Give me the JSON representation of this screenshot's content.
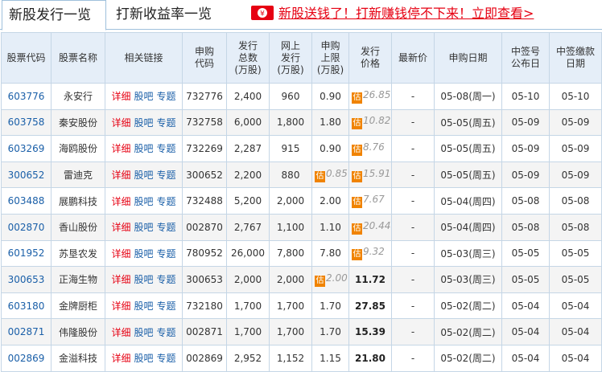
{
  "tabs": [
    {
      "label": "新股发行一览",
      "active": true
    },
    {
      "label": "打新收益率一览",
      "active": false
    }
  ],
  "promo": {
    "text": "新股送钱了！打新赚钱停不下来！立即查看>",
    "icon": "money-bag-icon"
  },
  "colors": {
    "accent_red": "#e60012",
    "link_blue": "#1a5fa8",
    "header_bg": "#e5eef8",
    "estimate_badge": "#f08300"
  },
  "estimate_badge": "估",
  "table": {
    "headers": {
      "code": "股票代码",
      "name": "股票名称",
      "links": "相关链接",
      "sub_code": [
        "申购",
        "代码"
      ],
      "total": [
        "发行",
        "总数",
        "(万股)"
      ],
      "online": [
        "网上",
        "发行",
        "(万股)"
      ],
      "limit": [
        "申购",
        "上限",
        "(万股)"
      ],
      "price": [
        "发行",
        "价格"
      ],
      "latest": "最新价",
      "sub_date": "申购日期",
      "announce": [
        "中签号",
        "公布日"
      ],
      "pay": [
        "中签缴款",
        "日期"
      ]
    },
    "link_labels": {
      "detail": "详细",
      "bar": "股吧",
      "topic": "专题"
    },
    "rows": [
      {
        "code": "603776",
        "name": "永安行",
        "sub_code": "732776",
        "total": "2,400",
        "online": "960",
        "limit": "0.90",
        "limit_est": false,
        "price": "26.85",
        "price_est": true,
        "latest": "-",
        "sub_date": "05-08(周一)",
        "announce": "05-10",
        "pay": "05-10"
      },
      {
        "code": "603758",
        "name": "秦安股份",
        "sub_code": "732758",
        "total": "6,000",
        "online": "1,800",
        "limit": "1.80",
        "limit_est": false,
        "price": "10.82",
        "price_est": true,
        "latest": "-",
        "sub_date": "05-05(周五)",
        "announce": "05-09",
        "pay": "05-09"
      },
      {
        "code": "603269",
        "name": "海鸥股份",
        "sub_code": "732269",
        "total": "2,287",
        "online": "915",
        "limit": "0.90",
        "limit_est": false,
        "price": "8.76",
        "price_est": true,
        "latest": "-",
        "sub_date": "05-05(周五)",
        "announce": "05-09",
        "pay": "05-09"
      },
      {
        "code": "300652",
        "name": "雷迪克",
        "sub_code": "300652",
        "total": "2,200",
        "online": "880",
        "limit": "0.85",
        "limit_est": true,
        "price": "15.91",
        "price_est": true,
        "latest": "-",
        "sub_date": "05-05(周五)",
        "announce": "05-09",
        "pay": "05-09"
      },
      {
        "code": "603488",
        "name": "展鹏科技",
        "sub_code": "732488",
        "total": "5,200",
        "online": "2,000",
        "limit": "2.00",
        "limit_est": false,
        "price": "7.67",
        "price_est": true,
        "latest": "-",
        "sub_date": "05-04(周四)",
        "announce": "05-08",
        "pay": "05-08"
      },
      {
        "code": "002870",
        "name": "香山股份",
        "sub_code": "002870",
        "total": "2,767",
        "online": "1,100",
        "limit": "1.10",
        "limit_est": false,
        "price": "20.44",
        "price_est": true,
        "latest": "-",
        "sub_date": "05-04(周四)",
        "announce": "05-08",
        "pay": "05-08"
      },
      {
        "code": "601952",
        "name": "苏垦农发",
        "sub_code": "780952",
        "total": "26,000",
        "online": "7,800",
        "limit": "7.80",
        "limit_est": false,
        "price": "9.32",
        "price_est": true,
        "latest": "-",
        "sub_date": "05-03(周三)",
        "announce": "05-05",
        "pay": "05-05"
      },
      {
        "code": "300653",
        "name": "正海生物",
        "sub_code": "300653",
        "total": "2,000",
        "online": "2,000",
        "limit": "2.00",
        "limit_est": true,
        "price": "11.72",
        "price_est": false,
        "latest": "-",
        "sub_date": "05-03(周三)",
        "announce": "05-05",
        "pay": "05-05"
      },
      {
        "code": "603180",
        "name": "金牌厨柜",
        "sub_code": "732180",
        "total": "1,700",
        "online": "1,700",
        "limit": "1.70",
        "limit_est": false,
        "price": "27.85",
        "price_est": false,
        "latest": "-",
        "sub_date": "05-02(周二)",
        "announce": "05-04",
        "pay": "05-04"
      },
      {
        "code": "002871",
        "name": "伟隆股份",
        "sub_code": "002871",
        "total": "1,700",
        "online": "1,700",
        "limit": "1.70",
        "limit_est": false,
        "price": "15.39",
        "price_est": false,
        "latest": "-",
        "sub_date": "05-02(周二)",
        "announce": "05-04",
        "pay": "05-04"
      },
      {
        "code": "002869",
        "name": "金溢科技",
        "sub_code": "002869",
        "total": "2,952",
        "online": "1,152",
        "limit": "1.15",
        "limit_est": false,
        "price": "21.80",
        "price_est": false,
        "latest": "-",
        "sub_date": "05-02(周二)",
        "announce": "05-04",
        "pay": "05-04"
      }
    ]
  }
}
